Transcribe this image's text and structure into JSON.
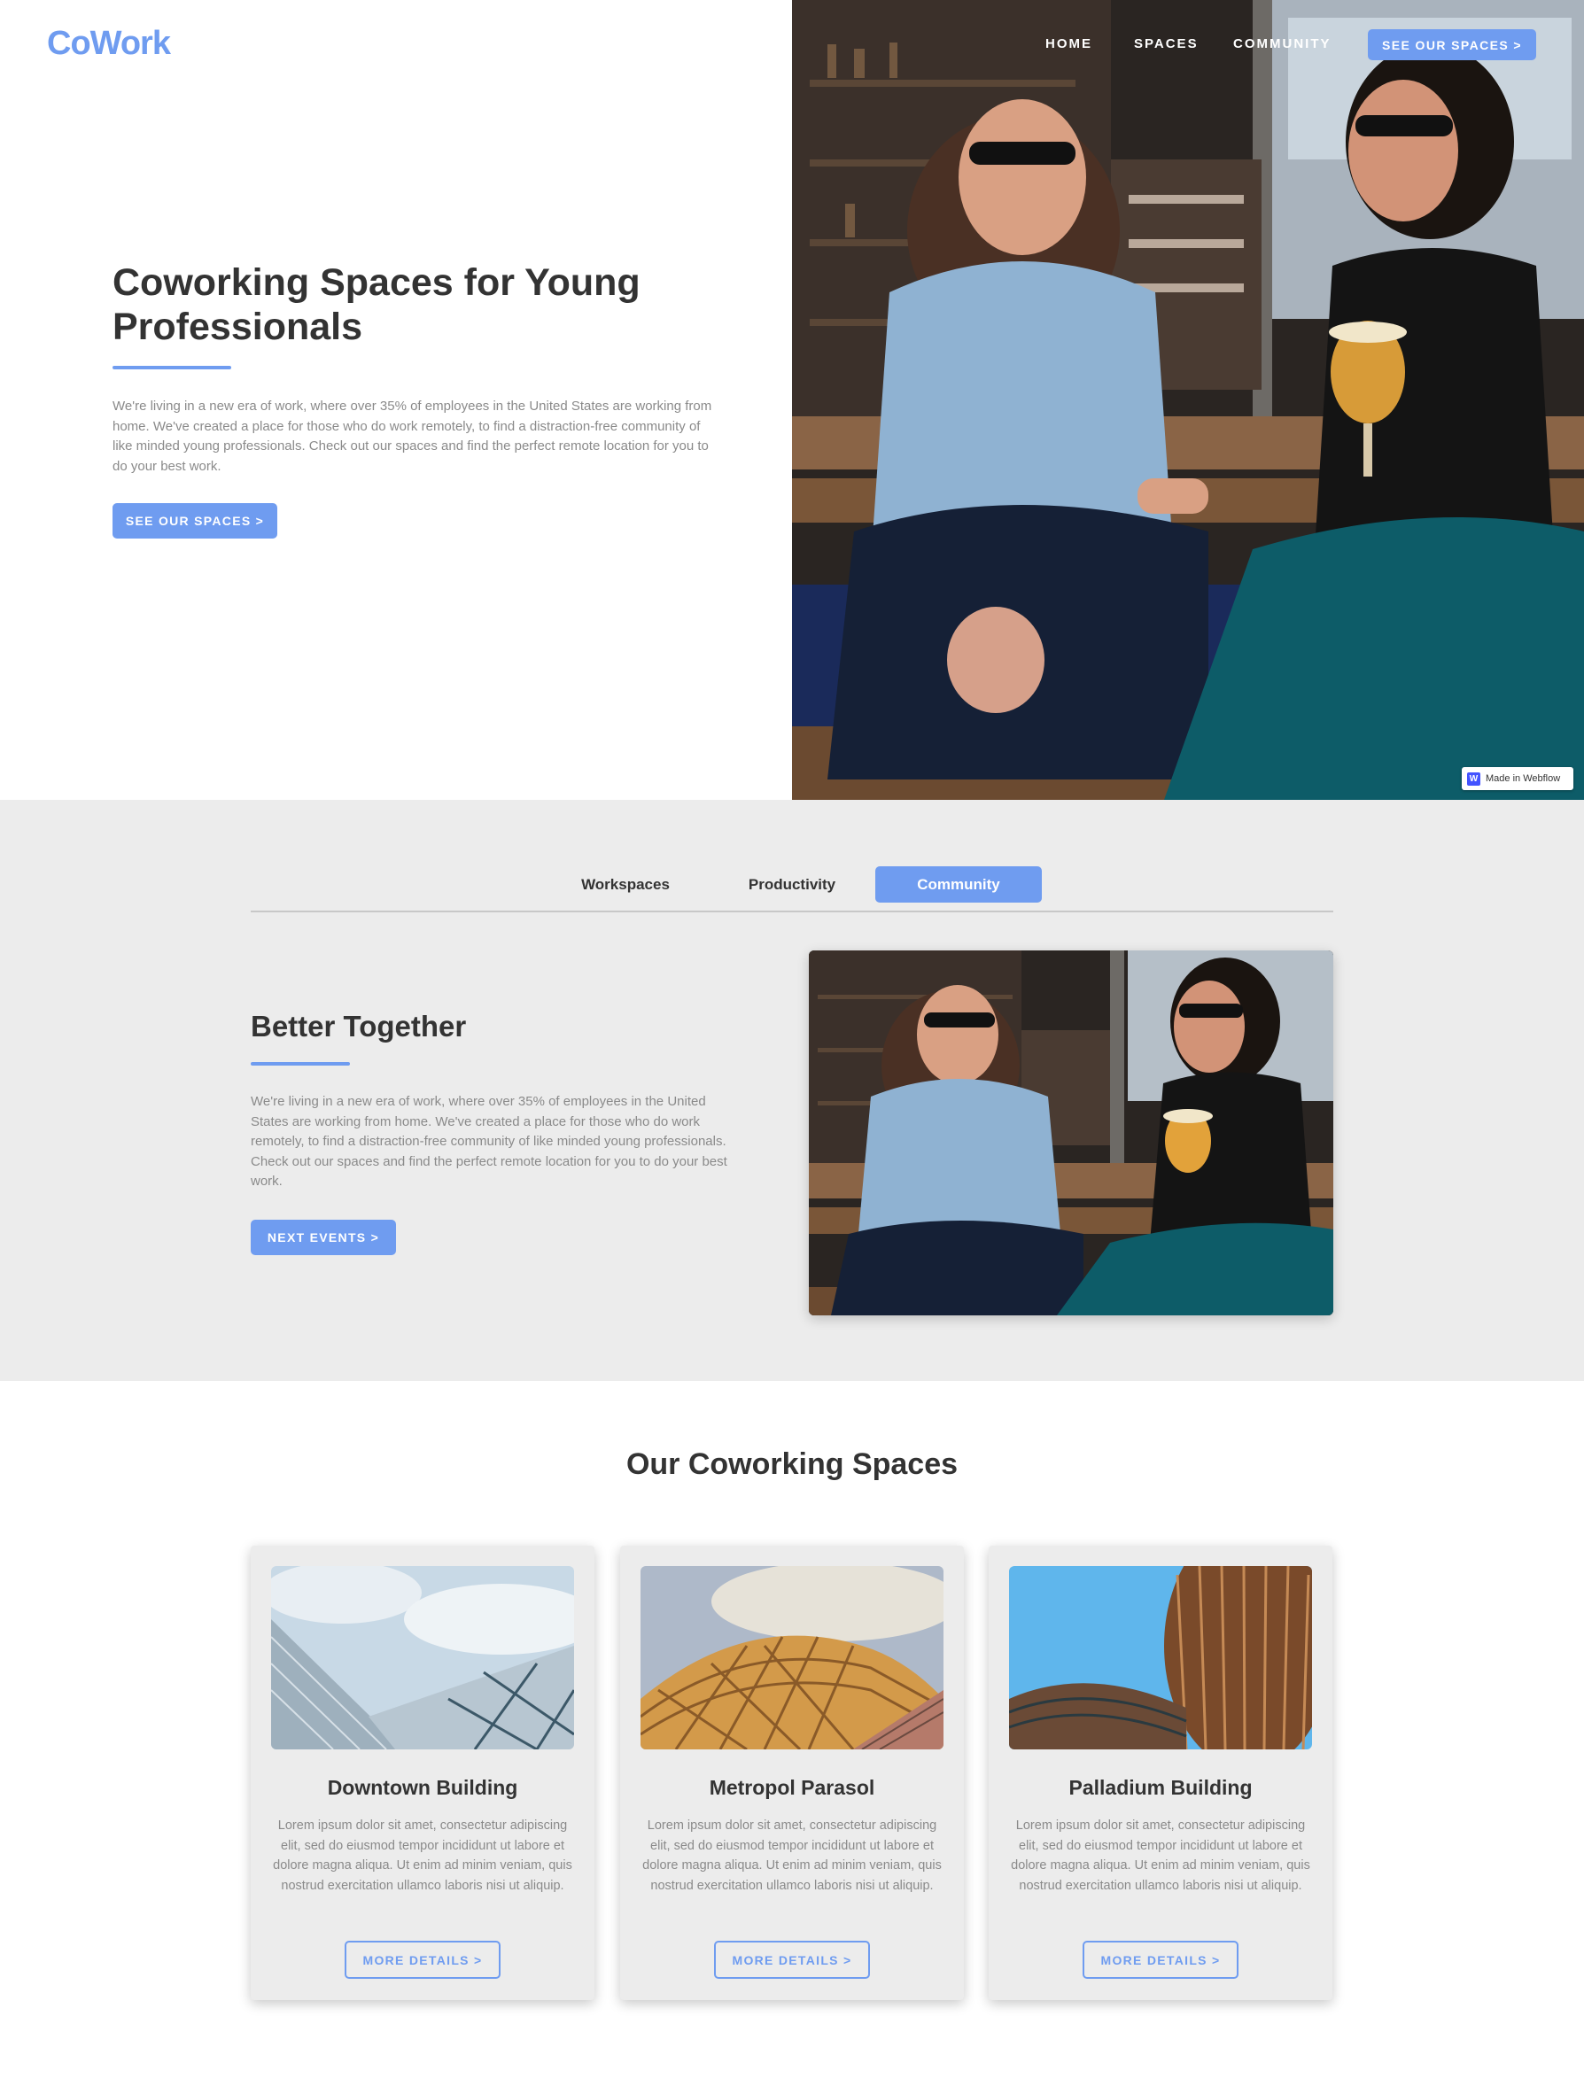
{
  "brand": {
    "logo": "CoWork",
    "accent_color": "#6f9cf0"
  },
  "nav": {
    "links": [
      "HOME",
      "SPACES",
      "COMMUNITY"
    ],
    "cta": "SEE OUR SPACES >"
  },
  "hero": {
    "title": "Coworking Spaces for Young Professionals",
    "text": "We're living in a new era of work, where over 35% of employees in the United States are working from home. We've created a place for those who do work remotely, to find a distraction-free community of like minded young professionals. Check out our spaces and find the perfect remote location for you to do your best work.",
    "button": "SEE OUR SPACES >",
    "badge": "Made in Webflow"
  },
  "tabs": {
    "items": [
      "Workspaces",
      "Productivity",
      "Community"
    ],
    "active": "Community",
    "panel": {
      "title": "Better Together",
      "text": "We're living in a new era of work, where over 35% of employees in the United States are working from home. We've created a place for those who do work remotely, to find a distraction-free community of like minded young professionals. Check out our spaces and find the perfect remote location for you to do your best work.",
      "button": "NEXT EVENTS >"
    }
  },
  "spaces": {
    "title": "Our Coworking Spaces",
    "cards": [
      {
        "name": "Downtown Building",
        "text": "Lorem ipsum dolor sit amet, consectetur adipiscing elit, sed do eiusmod tempor incididunt ut labore et dolore magna aliqua. Ut enim ad minim veniam, quis nostrud exercitation ullamco laboris nisi ut aliquip.",
        "button": "MORE DETAILS >"
      },
      {
        "name": "Metropol Parasol",
        "text": "Lorem ipsum dolor sit amet, consectetur adipiscing elit, sed do eiusmod tempor incididunt ut labore et dolore magna aliqua. Ut enim ad minim veniam, quis nostrud exercitation ullamco laboris nisi ut aliquip.",
        "button": "MORE DETAILS >"
      },
      {
        "name": "Palladium Building",
        "text": "Lorem ipsum dolor sit amet, consectetur adipiscing elit, sed do eiusmod tempor incididunt ut labore et dolore magna aliqua. Ut enim ad minim veniam, quis nostrud exercitation ullamco laboris nisi ut aliquip.",
        "button": "MORE DETAILS >"
      }
    ]
  }
}
